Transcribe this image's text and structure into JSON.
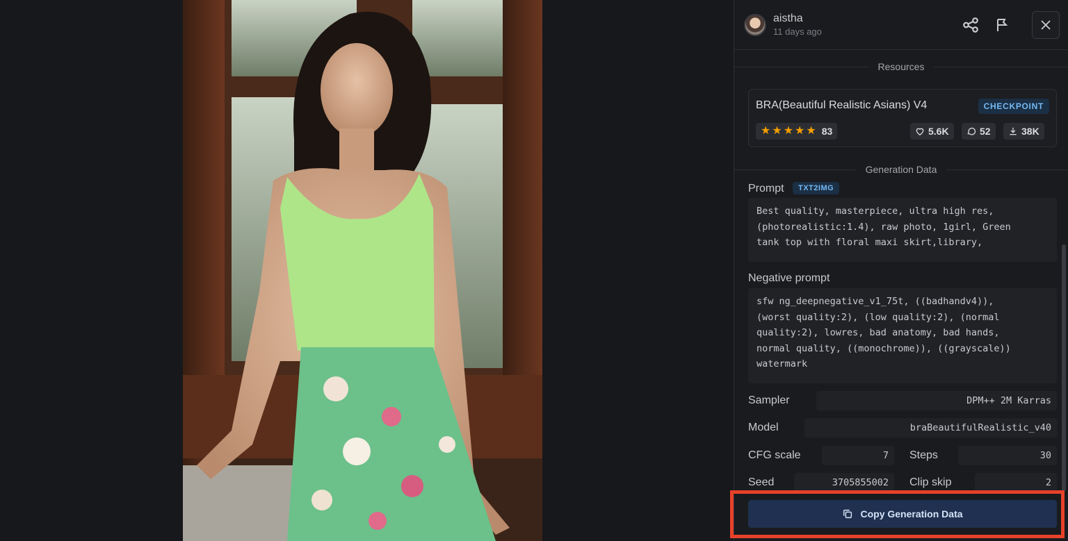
{
  "user": {
    "name": "aistha",
    "posted": "11 days ago"
  },
  "resources": {
    "heading": "Resources",
    "title": "BRA(Beautiful Realistic Asians) V4",
    "type_badge": "CHECKPOINT",
    "rating": 5,
    "rating_count": "83",
    "likes": "5.6K",
    "comments": "52",
    "downloads": "38K"
  },
  "generation": {
    "heading": "Generation Data",
    "prompt_label": "Prompt",
    "prompt_badge": "TXT2IMG",
    "prompt": "Best quality, masterpiece, ultra high res,\n(photorealistic:1.4), raw photo, 1girl, Green\ntank top with floral maxi skirt,library,",
    "negative_label": "Negative prompt",
    "negative": "sfw ng_deepnegative_v1_75t, ((badhandv4)),\n(worst quality:2), (low quality:2), (normal\nquality:2), lowres, bad anatomy, bad hands,\nnormal quality, ((monochrome)), ((grayscale))\nwatermark",
    "sampler_label": "Sampler",
    "sampler": "DPM++ 2M Karras",
    "model_label": "Model",
    "model": "braBeautifulRealistic_v40",
    "cfg_label": "CFG scale",
    "cfg": "7",
    "steps_label": "Steps",
    "steps": "30",
    "seed_label": "Seed",
    "seed": "3705855002",
    "clip_label": "Clip skip",
    "clip": "2"
  },
  "actions": {
    "copy_label": "Copy Generation Data"
  },
  "colors": {
    "accent": "#74b9f3",
    "star": "#f59f00",
    "highlight": "#e8412a",
    "button": "#1f3050"
  }
}
